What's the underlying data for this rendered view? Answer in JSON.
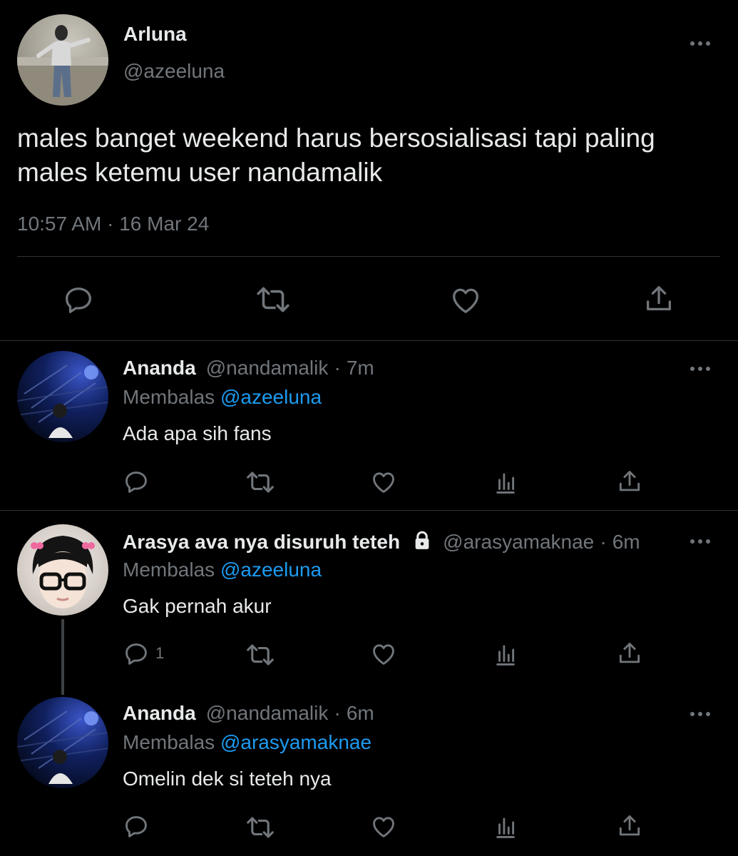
{
  "main_tweet": {
    "name": "Arluna",
    "handle": "@azeeluna",
    "text_line1": "males banget weekend harus bersosialisasi tapi paling",
    "text_line2": "males ketemu user nandamalik",
    "time": "10:57 AM",
    "separator": "·",
    "date": "16 Mar 24"
  },
  "replies": [
    {
      "name": "Ananda",
      "handle": "@nandamalik",
      "dot": "·",
      "time": "7m",
      "replying_label": "Membalas",
      "replying_to": "@azeeluna",
      "text": "Ada apa sih fans",
      "reply_count": ""
    },
    {
      "name": "Arasya ava nya disuruh teteh",
      "handle": "@arasyamaknae",
      "dot": "·",
      "time": "6m",
      "replying_label": "Membalas",
      "replying_to": "@azeeluna",
      "text": "Gak pernah akur",
      "reply_count": "1",
      "protected": true
    },
    {
      "name": "Ananda",
      "handle": "@nandamalik",
      "dot": "·",
      "time": "6m",
      "replying_label": "Membalas",
      "replying_to": "@arasyamaknae",
      "text": "Omelin dek si teteh nya",
      "reply_count": ""
    }
  ],
  "colors": {
    "background": "#000000",
    "text": "#e7e9ea",
    "secondary": "#71767b",
    "link": "#1d9bf0",
    "divider": "#2f3336"
  },
  "icons": [
    "more-icon",
    "reply-icon",
    "retweet-icon",
    "like-icon",
    "share-icon",
    "analytics-icon",
    "lock-icon"
  ]
}
